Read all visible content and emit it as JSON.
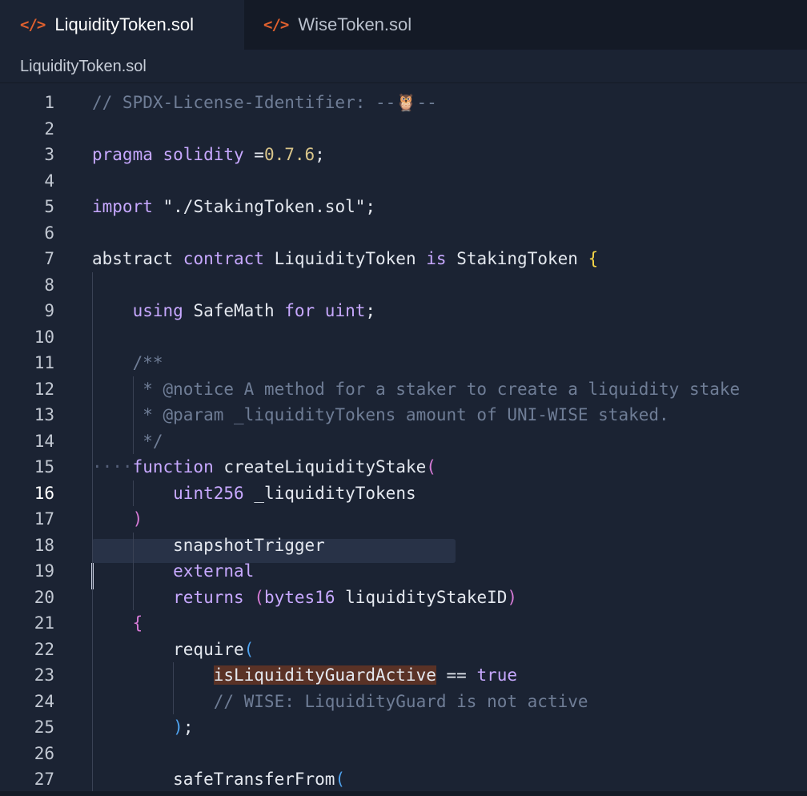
{
  "tabs": [
    {
      "icon": "</>",
      "label": "LiquidityToken.sol",
      "active": true
    },
    {
      "icon": "</>",
      "label": "WiseToken.sol",
      "active": false
    }
  ],
  "breadcrumb": "LiquidityToken.sol",
  "editor": {
    "current_line": 16,
    "lines": [
      {
        "n": "1",
        "parts": [
          {
            "c": "t-comment",
            "t": "// SPDX-License-Identifier: --🦉--"
          }
        ]
      },
      {
        "n": "2",
        "parts": []
      },
      {
        "n": "3",
        "parts": [
          {
            "c": "t-kw",
            "t": "pragma solidity "
          },
          {
            "c": "t-plain",
            "t": "="
          },
          {
            "c": "t-num",
            "t": "0.7.6"
          },
          {
            "c": "t-plain",
            "t": ";"
          }
        ]
      },
      {
        "n": "4",
        "parts": []
      },
      {
        "n": "5",
        "parts": [
          {
            "c": "t-kw",
            "t": "import "
          },
          {
            "c": "t-str",
            "t": "\"./StakingToken.sol\""
          },
          {
            "c": "t-plain",
            "t": ";"
          }
        ]
      },
      {
        "n": "6",
        "parts": []
      },
      {
        "n": "7",
        "parts": [
          {
            "c": "t-plain",
            "t": "abstract "
          },
          {
            "c": "t-kw",
            "t": "contract "
          },
          {
            "c": "t-plain",
            "t": "LiquidityToken "
          },
          {
            "c": "t-kw",
            "t": "is "
          },
          {
            "c": "t-plain",
            "t": "StakingToken "
          },
          {
            "c": "t-brace1",
            "t": "{"
          }
        ]
      },
      {
        "n": "8",
        "parts": []
      },
      {
        "n": "9",
        "parts": [
          {
            "c": "t-plain",
            "t": "    "
          },
          {
            "c": "t-kw",
            "t": "using "
          },
          {
            "c": "t-plain",
            "t": "SafeMath "
          },
          {
            "c": "t-kw",
            "t": "for uint"
          },
          {
            "c": "t-plain",
            "t": ";"
          }
        ]
      },
      {
        "n": "10",
        "parts": []
      },
      {
        "n": "11",
        "parts": [
          {
            "c": "t-comment",
            "t": "    /**"
          }
        ]
      },
      {
        "n": "12",
        "parts": [
          {
            "c": "t-comment",
            "t": "     * @notice A method for a staker to create a liquidity stake"
          }
        ]
      },
      {
        "n": "13",
        "parts": [
          {
            "c": "t-comment",
            "t": "     * @param _liquidityTokens amount of UNI-WISE staked."
          }
        ]
      },
      {
        "n": "14",
        "parts": [
          {
            "c": "t-comment",
            "t": "     */"
          }
        ]
      },
      {
        "n": "15",
        "parts": [
          {
            "c": "dots",
            "t": "····"
          },
          {
            "c": "t-kw",
            "t": "function "
          },
          {
            "c": "t-fn",
            "t": "createLiquidityStake"
          },
          {
            "c": "t-brace2",
            "t": "("
          }
        ]
      },
      {
        "n": "16",
        "parts": [
          {
            "c": "t-plain",
            "t": "        "
          },
          {
            "c": "t-kw",
            "t": "uint256 "
          },
          {
            "c": "t-plain",
            "t": "_liquidityTokens"
          }
        ]
      },
      {
        "n": "17",
        "parts": [
          {
            "c": "t-plain",
            "t": "    "
          },
          {
            "c": "t-brace2",
            "t": ")"
          }
        ]
      },
      {
        "n": "18",
        "parts": [
          {
            "c": "t-plain",
            "t": "        snapshotTrigger"
          }
        ]
      },
      {
        "n": "19",
        "parts": [
          {
            "c": "t-plain",
            "t": "        "
          },
          {
            "c": "t-kw",
            "t": "external"
          }
        ]
      },
      {
        "n": "20",
        "parts": [
          {
            "c": "t-plain",
            "t": "        "
          },
          {
            "c": "t-kw",
            "t": "returns "
          },
          {
            "c": "t-brace2",
            "t": "("
          },
          {
            "c": "t-kw",
            "t": "bytes16 "
          },
          {
            "c": "t-plain",
            "t": "liquidityStakeID"
          },
          {
            "c": "t-brace2",
            "t": ")"
          }
        ]
      },
      {
        "n": "21",
        "parts": [
          {
            "c": "t-plain",
            "t": "    "
          },
          {
            "c": "t-brace2",
            "t": "{"
          }
        ]
      },
      {
        "n": "22",
        "parts": [
          {
            "c": "t-plain",
            "t": "        require"
          },
          {
            "c": "t-brace3",
            "t": "("
          }
        ]
      },
      {
        "n": "23",
        "parts": [
          {
            "c": "t-plain",
            "t": "            "
          },
          {
            "c": "t-highlight",
            "t": "isLiquidityGuardActive"
          },
          {
            "c": "t-plain",
            "t": " == "
          },
          {
            "c": "t-kw",
            "t": "true"
          }
        ]
      },
      {
        "n": "24",
        "parts": [
          {
            "c": "t-plain",
            "t": "            "
          },
          {
            "c": "t-comment",
            "t": "// WISE: LiquidityGuard is not active"
          }
        ]
      },
      {
        "n": "25",
        "parts": [
          {
            "c": "t-plain",
            "t": "        "
          },
          {
            "c": "t-brace3",
            "t": ")"
          },
          {
            "c": "t-plain",
            "t": ";"
          }
        ]
      },
      {
        "n": "26",
        "parts": []
      },
      {
        "n": "27",
        "parts": [
          {
            "c": "t-plain",
            "t": "        safeTransferFrom"
          },
          {
            "c": "t-brace3",
            "t": "("
          }
        ]
      }
    ]
  }
}
